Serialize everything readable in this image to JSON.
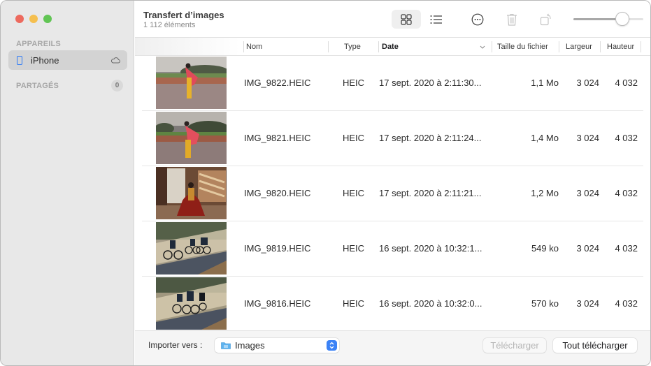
{
  "window": {
    "title": "Transfert d’images",
    "subtitle": "1 112 éléments"
  },
  "sidebar": {
    "sections": [
      {
        "label": "APPAREILS"
      },
      {
        "label": "PARTAGÉS",
        "count": "0"
      }
    ],
    "devices": [
      {
        "label": "iPhone",
        "icon": "iphone-icon",
        "status_icon": "cloud-icon",
        "selected": true
      }
    ]
  },
  "toolbar": {
    "buttons": [
      {
        "name": "grid-view",
        "icon": "grid-icon",
        "active": true
      },
      {
        "name": "list-view",
        "icon": "list-icon",
        "active": false
      },
      {
        "name": "more-actions",
        "icon": "ellipsis-circle-icon"
      },
      {
        "name": "delete",
        "icon": "trash-icon",
        "disabled": true
      },
      {
        "name": "rotate",
        "icon": "rotate-icon",
        "disabled": true
      }
    ],
    "zoom_slider_value": 0.75
  },
  "table": {
    "columns": [
      "Nom",
      "Type",
      "Date",
      "Taille du fichier",
      "Largeur",
      "Hauteur"
    ],
    "sorted_column": "Date",
    "sort_direction": "descending",
    "rows": [
      {
        "name": "IMG_9822.HEIC",
        "type": "HEIC",
        "date": "17 sept. 2020 à 2:11:30...",
        "size": "1,1 Mo",
        "width": "3 024",
        "height": "4 032",
        "thumb": "woman-saree-garden"
      },
      {
        "name": "IMG_9821.HEIC",
        "type": "HEIC",
        "date": "17 sept. 2020 à 2:11:24...",
        "size": "1,4 Mo",
        "width": "3 024",
        "height": "4 032",
        "thumb": "woman-saree-garden"
      },
      {
        "name": "IMG_9820.HEIC",
        "type": "HEIC",
        "date": "17 sept. 2020 à 2:11:21...",
        "size": "1,2 Mo",
        "width": "3 024",
        "height": "4 032",
        "thumb": "woman-lattice-window"
      },
      {
        "name": "IMG_9819.HEIC",
        "type": "HEIC",
        "date": "16 sept. 2020 à 10:32:1...",
        "size": "549 ko",
        "width": "3 024",
        "height": "4 032",
        "thumb": "cyclists-road"
      },
      {
        "name": "IMG_9816.HEIC",
        "type": "HEIC",
        "date": "16 sept. 2020 à 10:32:0...",
        "size": "570 ko",
        "width": "3 024",
        "height": "4 032",
        "thumb": "cyclists-road"
      }
    ]
  },
  "footer": {
    "import_label": "Importer vers :",
    "destination": "Images",
    "download_label": "Télécharger",
    "download_all_label": "Tout télécharger"
  },
  "colors": {
    "accent": "#3b82f6",
    "close": "#ed6a5e",
    "minimize": "#f5bf4f",
    "maximize": "#61c554"
  }
}
